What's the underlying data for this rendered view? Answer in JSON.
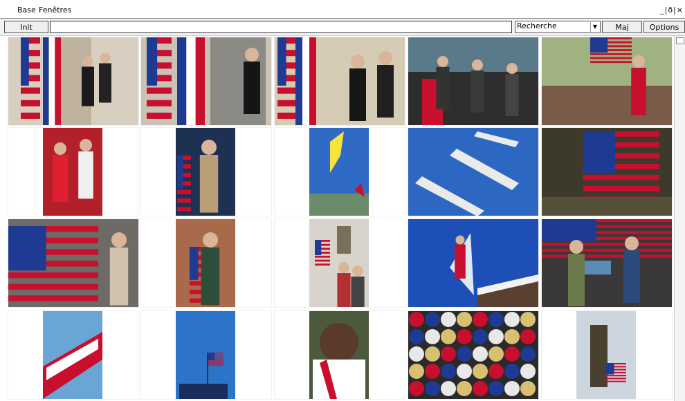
{
  "menubar": {
    "items": [
      {
        "label": "Base",
        "underline": "B"
      },
      {
        "label": "Fenêtres",
        "underline": "F"
      }
    ],
    "window_controls": "_|ð|×"
  },
  "toolbar": {
    "init_label": "Init",
    "address_value": "",
    "search_select_value": "Recherche",
    "maj_label": "Maj",
    "options_label": "Options"
  },
  "grid": {
    "rows": [
      [
        {
          "subject": "two-men-handshake-flags"
        },
        {
          "subject": "man-before-flags"
        },
        {
          "subject": "two-men-flags"
        },
        {
          "subject": "crowd-with-sashes"
        },
        {
          "subject": "parade-woman-flag"
        }
      ],
      [
        {
          "subject": "couple-red-dress"
        },
        {
          "subject": "soldier-with-flag"
        },
        {
          "subject": "yellow-flag-sky"
        },
        {
          "subject": "jets-formation"
        },
        {
          "subject": "waving-us-flag"
        }
      ],
      [
        {
          "subject": "flag-and-crowd"
        },
        {
          "subject": "athlete-with-flag"
        },
        {
          "subject": "monument-flag-crowd"
        },
        {
          "subject": "skier-jumping"
        },
        {
          "subject": "flag-mural-people"
        }
      ],
      [
        {
          "subject": "twa-aircraft-tail"
        },
        {
          "subject": "flag-on-pole-sky"
        },
        {
          "subject": "smiling-athlete"
        },
        {
          "subject": "campaign-buttons"
        },
        {
          "subject": "statue-with-flag"
        }
      ]
    ]
  },
  "colors": {
    "toolbar_bg": "#f2f2f2",
    "flag_red": "#c8102e",
    "flag_blue": "#1f3a93"
  }
}
